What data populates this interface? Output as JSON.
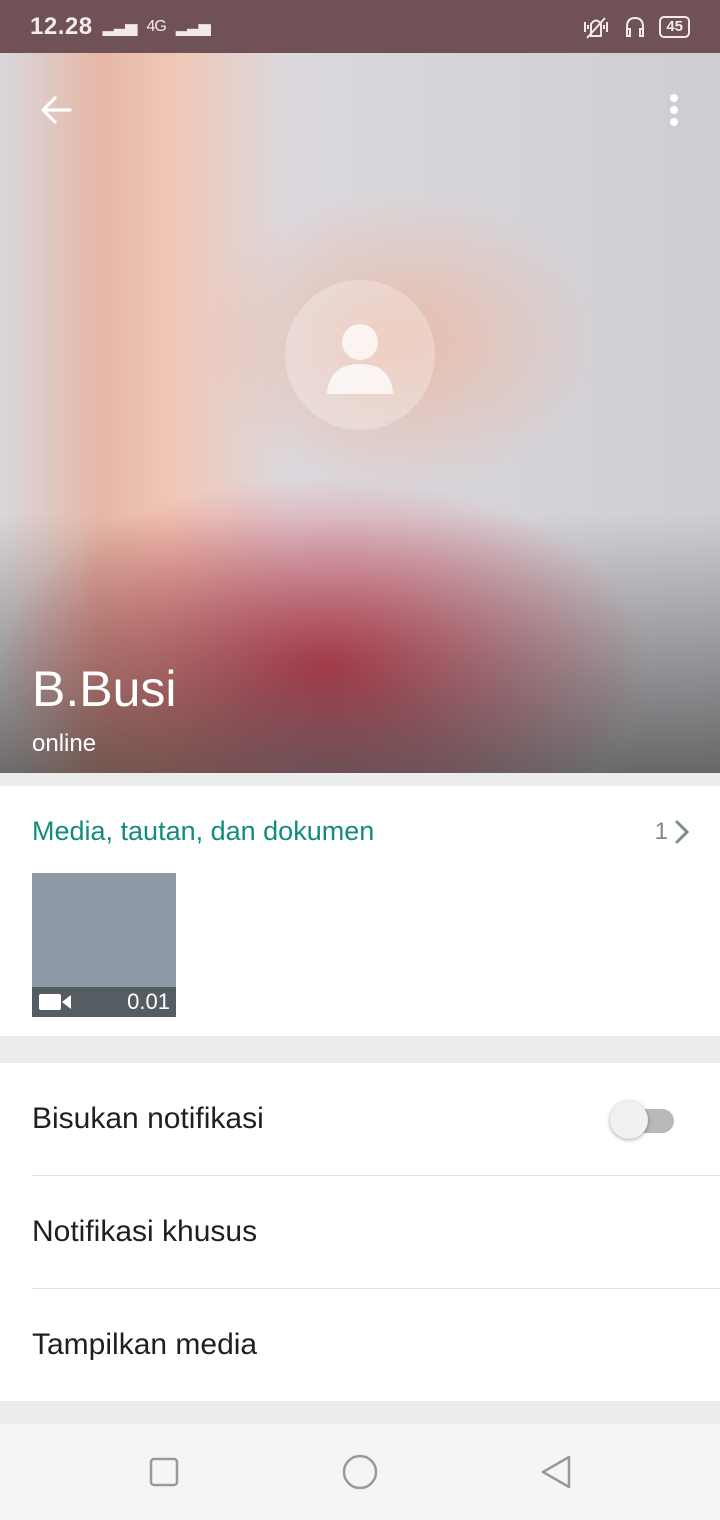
{
  "status_bar": {
    "time": "12.28",
    "network": "4G",
    "battery": "45"
  },
  "profile": {
    "name": "B.Busi",
    "status": "online"
  },
  "media": {
    "title": "Media, tautan, dan dokumen",
    "count": "1",
    "items": [
      {
        "type": "video",
        "duration": "0.01"
      }
    ]
  },
  "settings": {
    "mute_label": "Bisukan notifikasi",
    "mute_enabled": false,
    "custom_notif_label": "Notifikasi khusus",
    "show_media_label": "Tampilkan media"
  },
  "colors": {
    "accent": "#128c7e",
    "status_bar": "#6f5156"
  }
}
